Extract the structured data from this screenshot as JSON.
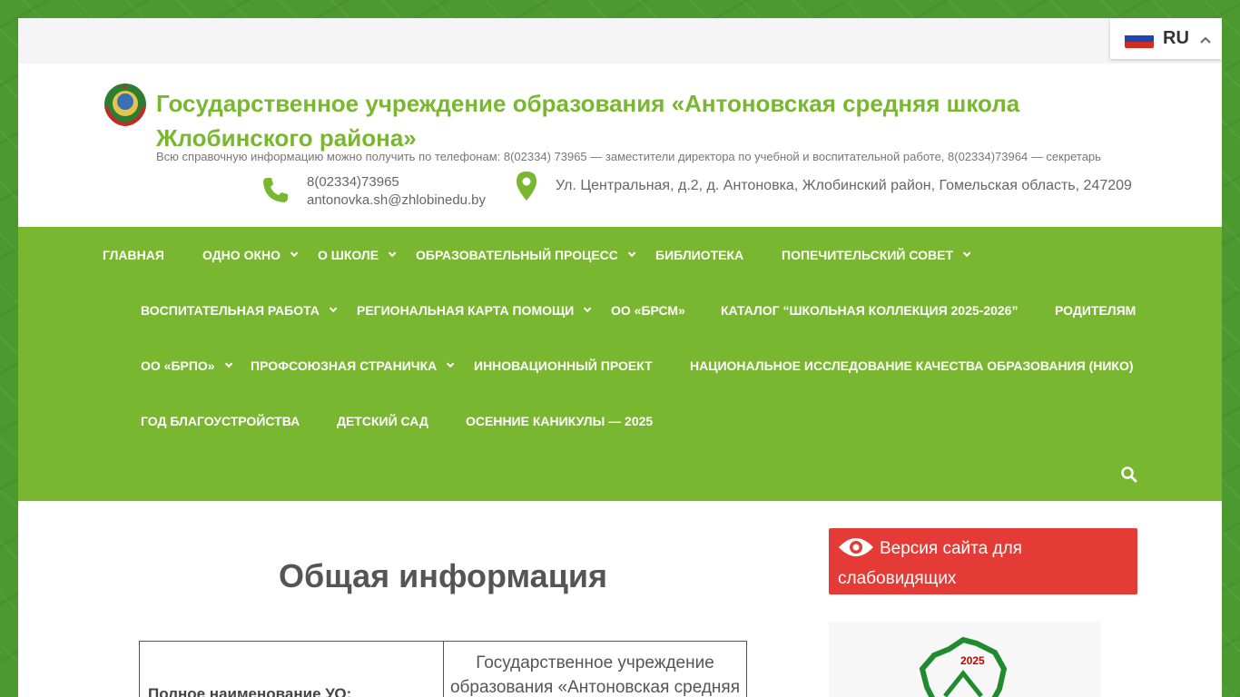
{
  "language": {
    "code": "RU"
  },
  "header": {
    "site_title": "Государственное учреждение образования «Антоновская средняя школа Жлобинского района»",
    "description": "Всю справочную информацию можно получить по телефонам: 8(02334) 73965 — заместители директора по учебной и воспитательной работе, 8(02334)73964 — секретарь",
    "phone": "8(02334)73965",
    "email": "antonovka.sh@zhlobinedu.by",
    "address": "Ул. Центральная, д.2, д. Антоновка, Жлобинский район, Гомельская область, 247209"
  },
  "nav": {
    "rows": [
      [
        {
          "label": "Главная",
          "has_sub": false
        },
        {
          "label": "Одно окно",
          "has_sub": true
        },
        {
          "label": "О школе",
          "has_sub": true
        },
        {
          "label": "Образовательный процесс",
          "has_sub": true
        },
        {
          "label": "Библиотека",
          "has_sub": false
        },
        {
          "label": "Попечительский совет",
          "has_sub": true
        }
      ],
      [
        {
          "label": "Воспитательная работа",
          "has_sub": true
        },
        {
          "label": "Региональная карта помощи",
          "has_sub": true
        },
        {
          "label": "ОО «БРСМ»",
          "has_sub": false
        },
        {
          "label": "Каталог “Школьная коллекция 2025-2026”",
          "has_sub": false
        },
        {
          "label": "Родителям",
          "has_sub": false
        }
      ],
      [
        {
          "label": "ОО «БРПО»",
          "has_sub": true
        },
        {
          "label": "Профсоюзная страничка",
          "has_sub": true
        },
        {
          "label": "Инновационный проект",
          "has_sub": false
        },
        {
          "label": "Национальное исследование качества образования (НИКО)",
          "has_sub": false
        }
      ],
      [
        {
          "label": "Год благоустройства",
          "has_sub": false
        },
        {
          "label": "Детский сад",
          "has_sub": false
        },
        {
          "label": "Осенние каникулы — 2025",
          "has_sub": false
        }
      ]
    ]
  },
  "main": {
    "page_title": "Общая информация",
    "table": {
      "row1_label": "Полное наименование УО:",
      "row1_value": "Государственное учреждение образования «Антоновская средняя"
    }
  },
  "sidebar": {
    "accessibility_label": "Версия сайта для слабовидящих",
    "widget_year": "2025"
  },
  "colors": {
    "brand_green": "#7ab730",
    "accent_red": "#e43b36"
  }
}
